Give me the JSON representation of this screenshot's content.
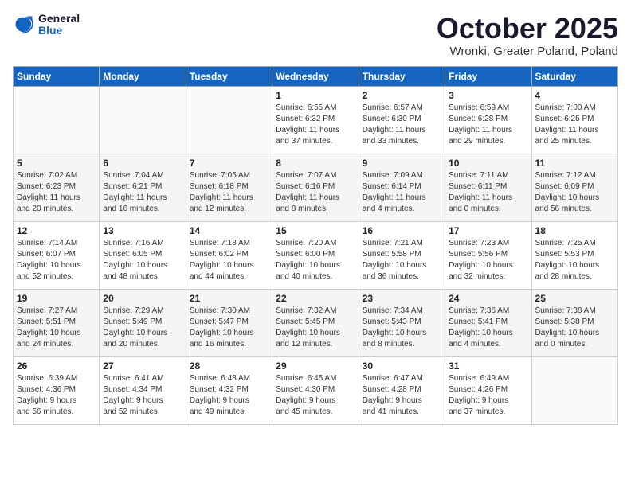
{
  "header": {
    "logo_general": "General",
    "logo_blue": "Blue",
    "month": "October 2025",
    "location": "Wronki, Greater Poland, Poland"
  },
  "days_of_week": [
    "Sunday",
    "Monday",
    "Tuesday",
    "Wednesday",
    "Thursday",
    "Friday",
    "Saturday"
  ],
  "weeks": [
    [
      {
        "day": "",
        "info": ""
      },
      {
        "day": "",
        "info": ""
      },
      {
        "day": "",
        "info": ""
      },
      {
        "day": "1",
        "info": "Sunrise: 6:55 AM\nSunset: 6:32 PM\nDaylight: 11 hours\nand 37 minutes."
      },
      {
        "day": "2",
        "info": "Sunrise: 6:57 AM\nSunset: 6:30 PM\nDaylight: 11 hours\nand 33 minutes."
      },
      {
        "day": "3",
        "info": "Sunrise: 6:59 AM\nSunset: 6:28 PM\nDaylight: 11 hours\nand 29 minutes."
      },
      {
        "day": "4",
        "info": "Sunrise: 7:00 AM\nSunset: 6:25 PM\nDaylight: 11 hours\nand 25 minutes."
      }
    ],
    [
      {
        "day": "5",
        "info": "Sunrise: 7:02 AM\nSunset: 6:23 PM\nDaylight: 11 hours\nand 20 minutes."
      },
      {
        "day": "6",
        "info": "Sunrise: 7:04 AM\nSunset: 6:21 PM\nDaylight: 11 hours\nand 16 minutes."
      },
      {
        "day": "7",
        "info": "Sunrise: 7:05 AM\nSunset: 6:18 PM\nDaylight: 11 hours\nand 12 minutes."
      },
      {
        "day": "8",
        "info": "Sunrise: 7:07 AM\nSunset: 6:16 PM\nDaylight: 11 hours\nand 8 minutes."
      },
      {
        "day": "9",
        "info": "Sunrise: 7:09 AM\nSunset: 6:14 PM\nDaylight: 11 hours\nand 4 minutes."
      },
      {
        "day": "10",
        "info": "Sunrise: 7:11 AM\nSunset: 6:11 PM\nDaylight: 11 hours\nand 0 minutes."
      },
      {
        "day": "11",
        "info": "Sunrise: 7:12 AM\nSunset: 6:09 PM\nDaylight: 10 hours\nand 56 minutes."
      }
    ],
    [
      {
        "day": "12",
        "info": "Sunrise: 7:14 AM\nSunset: 6:07 PM\nDaylight: 10 hours\nand 52 minutes."
      },
      {
        "day": "13",
        "info": "Sunrise: 7:16 AM\nSunset: 6:05 PM\nDaylight: 10 hours\nand 48 minutes."
      },
      {
        "day": "14",
        "info": "Sunrise: 7:18 AM\nSunset: 6:02 PM\nDaylight: 10 hours\nand 44 minutes."
      },
      {
        "day": "15",
        "info": "Sunrise: 7:20 AM\nSunset: 6:00 PM\nDaylight: 10 hours\nand 40 minutes."
      },
      {
        "day": "16",
        "info": "Sunrise: 7:21 AM\nSunset: 5:58 PM\nDaylight: 10 hours\nand 36 minutes."
      },
      {
        "day": "17",
        "info": "Sunrise: 7:23 AM\nSunset: 5:56 PM\nDaylight: 10 hours\nand 32 minutes."
      },
      {
        "day": "18",
        "info": "Sunrise: 7:25 AM\nSunset: 5:53 PM\nDaylight: 10 hours\nand 28 minutes."
      }
    ],
    [
      {
        "day": "19",
        "info": "Sunrise: 7:27 AM\nSunset: 5:51 PM\nDaylight: 10 hours\nand 24 minutes."
      },
      {
        "day": "20",
        "info": "Sunrise: 7:29 AM\nSunset: 5:49 PM\nDaylight: 10 hours\nand 20 minutes."
      },
      {
        "day": "21",
        "info": "Sunrise: 7:30 AM\nSunset: 5:47 PM\nDaylight: 10 hours\nand 16 minutes."
      },
      {
        "day": "22",
        "info": "Sunrise: 7:32 AM\nSunset: 5:45 PM\nDaylight: 10 hours\nand 12 minutes."
      },
      {
        "day": "23",
        "info": "Sunrise: 7:34 AM\nSunset: 5:43 PM\nDaylight: 10 hours\nand 8 minutes."
      },
      {
        "day": "24",
        "info": "Sunrise: 7:36 AM\nSunset: 5:41 PM\nDaylight: 10 hours\nand 4 minutes."
      },
      {
        "day": "25",
        "info": "Sunrise: 7:38 AM\nSunset: 5:38 PM\nDaylight: 10 hours\nand 0 minutes."
      }
    ],
    [
      {
        "day": "26",
        "info": "Sunrise: 6:39 AM\nSunset: 4:36 PM\nDaylight: 9 hours\nand 56 minutes."
      },
      {
        "day": "27",
        "info": "Sunrise: 6:41 AM\nSunset: 4:34 PM\nDaylight: 9 hours\nand 52 minutes."
      },
      {
        "day": "28",
        "info": "Sunrise: 6:43 AM\nSunset: 4:32 PM\nDaylight: 9 hours\nand 49 minutes."
      },
      {
        "day": "29",
        "info": "Sunrise: 6:45 AM\nSunset: 4:30 PM\nDaylight: 9 hours\nand 45 minutes."
      },
      {
        "day": "30",
        "info": "Sunrise: 6:47 AM\nSunset: 4:28 PM\nDaylight: 9 hours\nand 41 minutes."
      },
      {
        "day": "31",
        "info": "Sunrise: 6:49 AM\nSunset: 4:26 PM\nDaylight: 9 hours\nand 37 minutes."
      },
      {
        "day": "",
        "info": ""
      }
    ]
  ]
}
